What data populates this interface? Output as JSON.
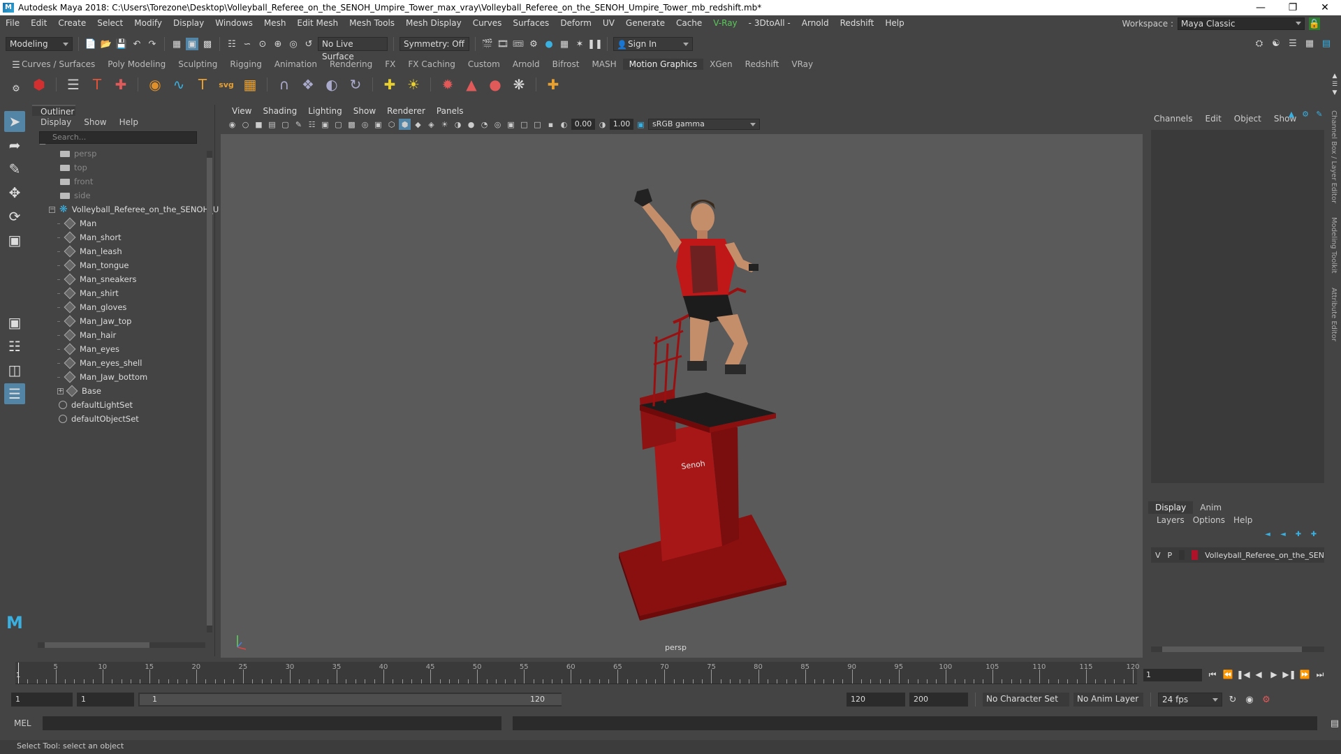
{
  "window": {
    "title": "Autodesk Maya 2018: C:\\Users\\Torezone\\Desktop\\Volleyball_Referee_on_the_SENOH_Umpire_Tower_max_vray\\Volleyball_Referee_on_the_SENOH_Umpire_Tower_mb_redshift.mb*"
  },
  "menubar": [
    "File",
    "Edit",
    "Create",
    "Select",
    "Modify",
    "Display",
    "Windows",
    "Mesh",
    "Edit Mesh",
    "Mesh Tools",
    "Mesh Display",
    "Curves",
    "Surfaces",
    "Deform",
    "UV",
    "Generate",
    "Cache",
    "V-Ray",
    "- 3DtoAll -",
    "Arnold",
    "Redshift",
    "Help"
  ],
  "workspace": {
    "label": "Workspace :",
    "value": "Maya Classic"
  },
  "statusline": {
    "mode": "Modeling",
    "live_surface": "No Live Surface",
    "symmetry": "Symmetry: Off",
    "sign_in": "Sign In"
  },
  "shelf_tabs": [
    "Curves / Surfaces",
    "Poly Modeling",
    "Sculpting",
    "Rigging",
    "Animation",
    "Rendering",
    "FX",
    "FX Caching",
    "Custom",
    "Arnold",
    "Bifrost",
    "MASH",
    "Motion Graphics",
    "XGen",
    "Redshift",
    "VRay"
  ],
  "shelf_active": "Motion Graphics",
  "outliner": {
    "title": "Outliner",
    "menu": [
      "Display",
      "Show",
      "Help"
    ],
    "search_placeholder": "Search...",
    "cameras": [
      "persp",
      "top",
      "front",
      "side"
    ],
    "root": "Volleyball_Referee_on_the_SENOH_U",
    "children": [
      "Man",
      "Man_short",
      "Man_leash",
      "Man_tongue",
      "Man_sneakers",
      "Man_shirt",
      "Man_gloves",
      "Man_Jaw_top",
      "Man_hair",
      "Man_eyes",
      "Man_eyes_shell",
      "Man_Jaw_bottom",
      "Base"
    ],
    "sets": [
      "defaultLightSet",
      "defaultObjectSet"
    ]
  },
  "viewport": {
    "menu": [
      "View",
      "Shading",
      "Lighting",
      "Show",
      "Renderer",
      "Panels"
    ],
    "exposure": "0.00",
    "gamma": "1.00",
    "colorspace": "sRGB gamma",
    "camera_label": "persp",
    "logo_text": "Senoh"
  },
  "channelbox": {
    "menu": [
      "Channels",
      "Edit",
      "Object",
      "Show"
    ]
  },
  "layers": {
    "tabs": [
      "Display",
      "Anim"
    ],
    "menu": [
      "Layers",
      "Options",
      "Help"
    ],
    "row": {
      "v": "V",
      "p": "P",
      "name": "Volleyball_Referee_on_the_SEN",
      "color": "#b0122a"
    }
  },
  "side_tabs": [
    "Channel Box / Layer Editor",
    "Modeling Toolkit",
    "Attribute Editor"
  ],
  "timeslider": {
    "ticks": [
      5,
      10,
      15,
      20,
      25,
      30,
      35,
      40,
      45,
      50,
      55,
      60,
      65,
      70,
      75,
      80,
      85,
      90,
      95,
      100,
      105,
      110,
      115,
      120
    ],
    "start_label": "1",
    "current_frame": "1"
  },
  "range": {
    "start": "1",
    "playback_start": "1",
    "range_start": "1",
    "range_end": "120",
    "end": "120",
    "anim_end": "200",
    "character_set": "No Character Set",
    "anim_layer": "No Anim Layer",
    "fps": "24 fps"
  },
  "cmdline": {
    "label": "MEL"
  },
  "helpline": "Select Tool: select an object"
}
